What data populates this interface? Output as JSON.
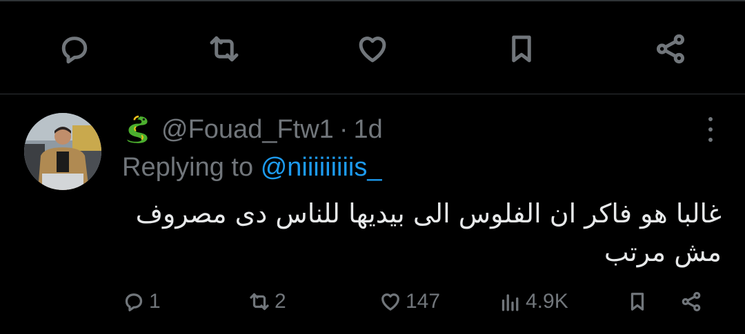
{
  "top_actions": [
    {
      "name": "reply",
      "icon": "comment-icon"
    },
    {
      "name": "retweet",
      "icon": "retweet-icon"
    },
    {
      "name": "like",
      "icon": "heart-icon"
    },
    {
      "name": "bookmark",
      "icon": "bookmark-icon"
    },
    {
      "name": "share",
      "icon": "share-icon"
    }
  ],
  "reply": {
    "emoji_icon": "dragon-emoji-icon",
    "handle": "@Fouad_Ftw1",
    "separator": "·",
    "time": "1d",
    "replying_prefix": "Replying to",
    "replying_to": "@niiiiiiiiis_",
    "text": "غالبا هو فاكر ان الفلوس الى بيديها للناس دى مصروف مش مرتب",
    "stats": {
      "replies": "1",
      "retweets": "2",
      "likes": "147",
      "views": "4.9K"
    }
  },
  "colors": {
    "background": "#000000",
    "text": "#e7e9ea",
    "muted": "#71767b",
    "link": "#1d9bf0",
    "divider": "#2f3336"
  }
}
